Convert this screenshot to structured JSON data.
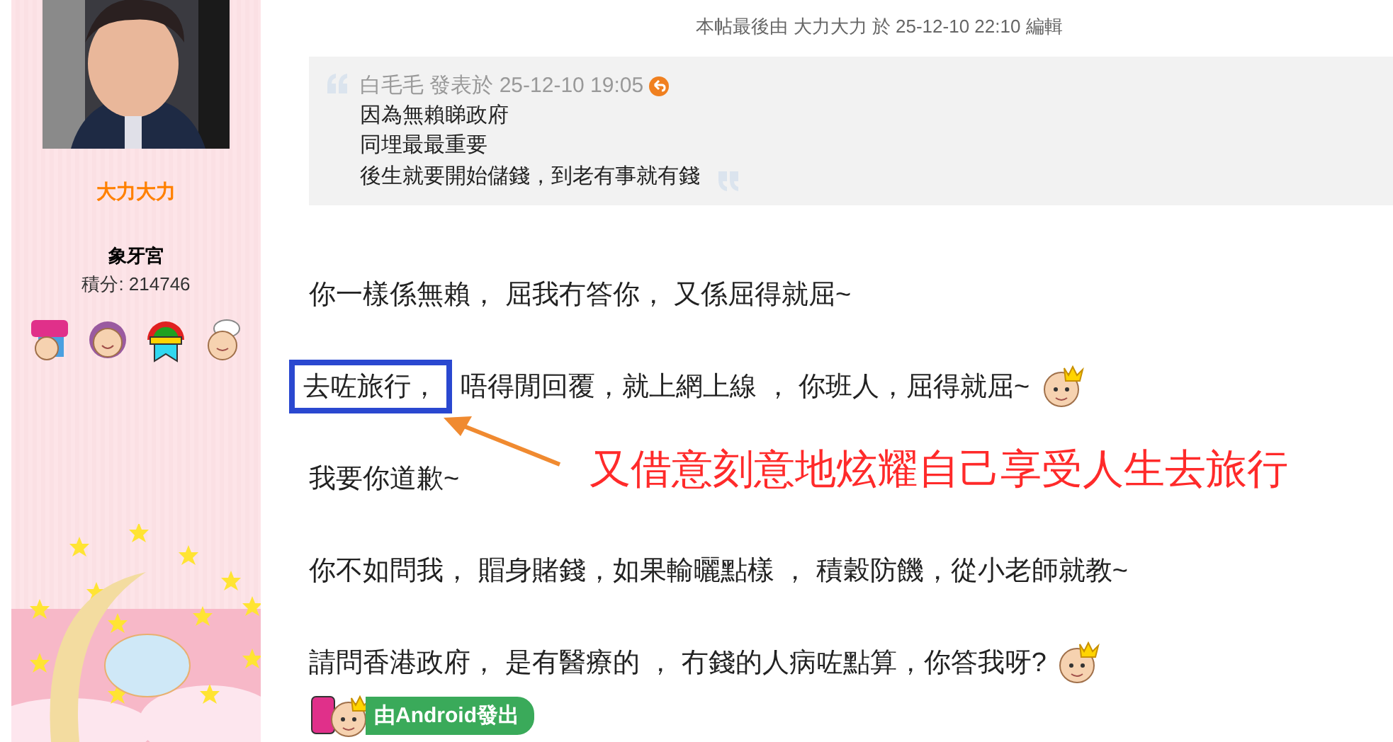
{
  "sidebar": {
    "username": "大力大力",
    "group": "象牙宮",
    "points": "積分: 214746",
    "medals": [
      {
        "kind": "year"
      },
      {
        "kind": "face"
      },
      {
        "kind": "rainbow"
      },
      {
        "kind": "chef"
      }
    ]
  },
  "post": {
    "edit_note": "本帖最後由 大力大力 於 25-12-10 22:10 編輯",
    "quote": {
      "author_line": "白毛毛 發表於 25-12-10 19:05",
      "lines": [
        "因為無賴睇政府",
        "同埋最最重要",
        "後生就要開始儲錢，到老有事就有錢"
      ]
    },
    "paragraphs": [
      {
        "text": "你一樣係無賴， 屈我冇答你， 又係屈得就屈~",
        "emoticon": false
      },
      {
        "highlight": "去咗旅行，",
        "text": "唔得閒回覆，就上網上線 ， 你班人，屈得就屈~",
        "emoticon": true
      },
      {
        "text": "我要你道歉~",
        "emoticon": false
      },
      {
        "text": "你不如問我， 賵身賭錢，如果輸曬點樣 ， 積穀防饑，從小老師就教~",
        "emoticon": false
      },
      {
        "text": "請問香港政府， 是有醫療的 ， 冇錢的人病咗點算，你答我呀?",
        "emoticon": true
      }
    ],
    "device_badge": "由Android發出",
    "annotation": {
      "text": "又借意刻意地炫耀自己享受人生去旅行"
    }
  }
}
